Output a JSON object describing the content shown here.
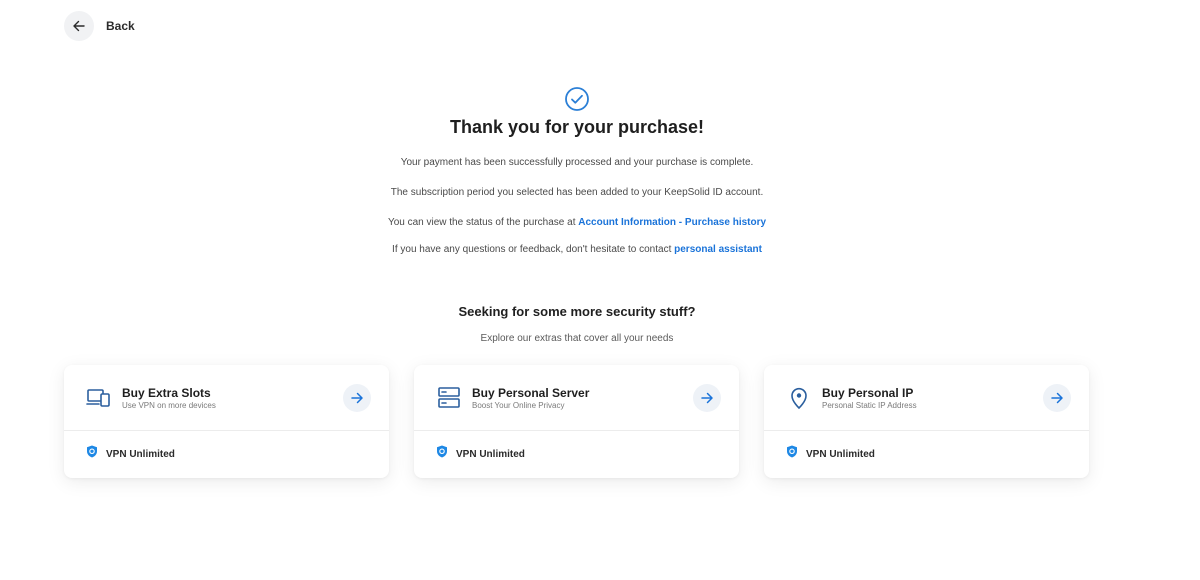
{
  "header": {
    "back_label": "Back"
  },
  "confirmation": {
    "title": "Thank you for your purchase!",
    "line1": "Your payment has been successfully processed and your purchase is complete.",
    "line2": "The subscription period you selected has been added to your KeepSolid ID account.",
    "line3_prefix": "You can view the status of the purchase at ",
    "line3_link": "Account Information - Purchase history",
    "line4_prefix": "If you have any questions or feedback, don't hesitate to contact ",
    "line4_link": "personal assistant"
  },
  "extras": {
    "title": "Seeking for some more security stuff?",
    "subtitle": "Explore our extras that cover all your needs",
    "cards": [
      {
        "title": "Buy Extra Slots",
        "desc": "Use VPN on more devices",
        "product": "VPN Unlimited",
        "icon": "devices-icon"
      },
      {
        "title": "Buy Personal Server",
        "desc": "Boost Your Online Privacy",
        "product": "VPN Unlimited",
        "icon": "server-icon"
      },
      {
        "title": "Buy Personal IP",
        "desc": "Personal Static IP Address",
        "product": "VPN Unlimited",
        "icon": "location-pin-icon"
      }
    ]
  },
  "colors": {
    "accent": "#1a73d9",
    "arrow_bg": "#eef2f7",
    "check": "#2b7fd6",
    "icon": "#2b5f9e"
  }
}
